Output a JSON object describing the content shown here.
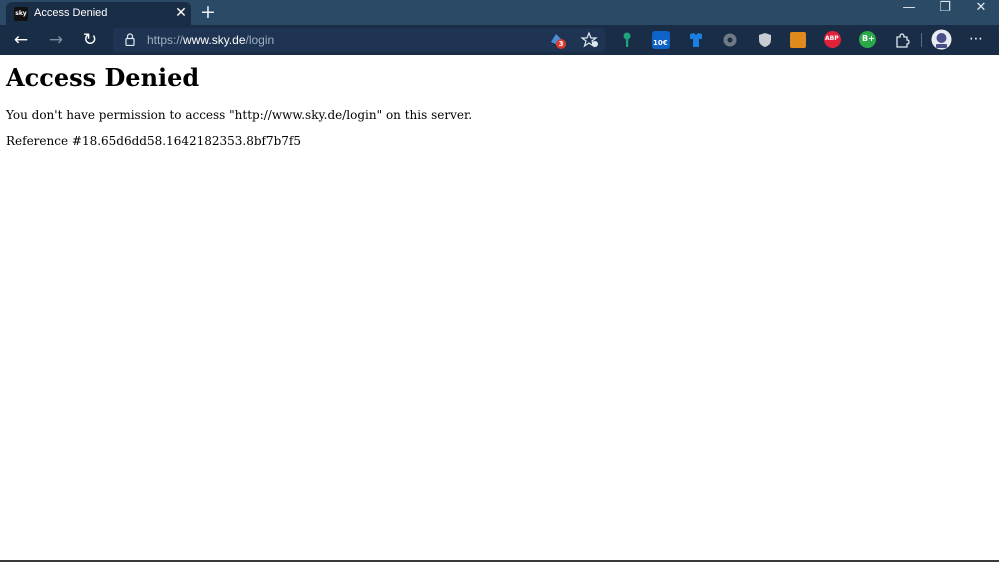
{
  "tab": {
    "title": "Access Denied",
    "favicon_text": "sky"
  },
  "browser": {
    "url_scheme": "https://",
    "url_host": "www.sky.de",
    "url_path": "/login",
    "extensions": [
      {
        "name": "cloud-extension-icon",
        "badge": "3"
      },
      {
        "name": "favorites-star-icon"
      },
      {
        "name": "key-extension-icon"
      },
      {
        "name": "price-extension-icon",
        "badge": "10€"
      },
      {
        "name": "shirt-extension-icon"
      },
      {
        "name": "dark-circle-extension-icon"
      },
      {
        "name": "shield-extension-icon"
      },
      {
        "name": "orange-extension-icon"
      },
      {
        "name": "abp-extension-icon",
        "label": "ABP"
      },
      {
        "name": "b-plus-extension-icon",
        "label": "B+"
      },
      {
        "name": "puzzle-extensions-icon"
      },
      {
        "name": "profile-avatar"
      },
      {
        "name": "more-menu-icon"
      }
    ]
  },
  "page": {
    "heading": "Access Denied",
    "message": "You don't have permission to access \"http://www.sky.de/login\" on this server.",
    "reference": "Reference #18.65d6dd58.1642182353.8bf7b7f5"
  },
  "colors": {
    "titlebar": "#2a4a66",
    "toolbar": "#1a2d47",
    "address": "#1e3452"
  }
}
